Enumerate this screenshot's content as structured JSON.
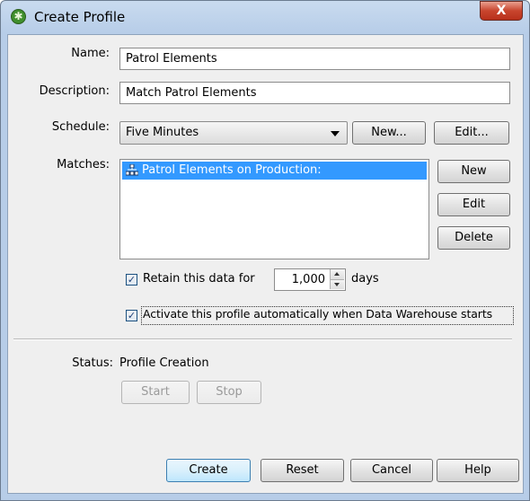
{
  "window": {
    "title": "Create Profile",
    "close_glyph": "X",
    "app_icon": "green-asterisk-icon"
  },
  "form": {
    "name_label": "Name:",
    "name_value": "Patrol Elements",
    "description_label": "Description:",
    "description_value": "Match Patrol Elements",
    "schedule_label": "Schedule:",
    "schedule_value": "Five Minutes",
    "schedule_new_button": "New...",
    "schedule_edit_button": "Edit...",
    "matches_label": "Matches:",
    "matches": [
      {
        "label": "Patrol Elements on Production:",
        "icon": "hierarchy-icon",
        "selected": true
      }
    ],
    "matches_new_button": "New",
    "matches_edit_button": "Edit",
    "matches_delete_button": "Delete",
    "retain_checked": true,
    "retain_label": "Retain this data for",
    "retain_value": "1,000",
    "retain_unit": "days",
    "activate_checked": true,
    "activate_label": "Activate this profile automatically when Data Warehouse starts"
  },
  "status": {
    "label": "Status:",
    "value": "Profile Creation",
    "start_button": "Start",
    "stop_button": "Stop"
  },
  "footer": {
    "create_button": "Create",
    "reset_button": "Reset",
    "cancel_button": "Cancel",
    "help_button": "Help"
  },
  "colors": {
    "selection": "#3399ff",
    "title_gradient": "#c9dbef",
    "close_red": "#c8452e"
  }
}
